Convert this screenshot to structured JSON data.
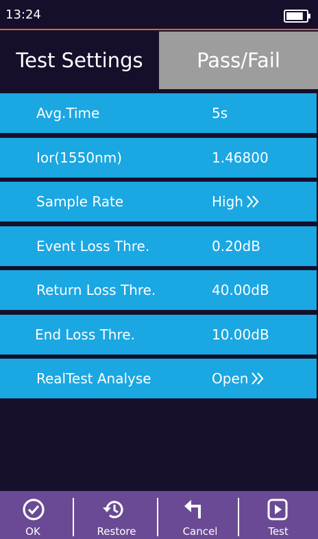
{
  "status": {
    "time": "13:24",
    "battery_level": 0.85
  },
  "tabs": [
    {
      "label": "Test Settings",
      "active": true
    },
    {
      "label": "Pass/Fail",
      "active": false
    }
  ],
  "settings": [
    {
      "label": "Avg.Time",
      "value": "5s"
    },
    {
      "label": "Ior(1550nm)",
      "value": "1.46800"
    },
    {
      "label": "Sample Rate",
      "value": "High"
    },
    {
      "label": "Event Loss Thre.",
      "value": "0.20dB"
    },
    {
      "label": "Return Loss Thre.",
      "value": "40.00dB"
    },
    {
      "label": "End Loss Thre.",
      "value": "10.00dB"
    },
    {
      "label": "RealTest Analyse",
      "value": "Open"
    }
  ],
  "toolbar": {
    "ok": "OK",
    "restore": "Restore",
    "cancel": "Cancel",
    "test": "Test"
  },
  "colors": {
    "background": "#160f2b",
    "row": "#1aa7e2",
    "tab_inactive": "#9d9d9d",
    "toolbar": "#6a4a94",
    "accent_line": "#e0682e"
  }
}
